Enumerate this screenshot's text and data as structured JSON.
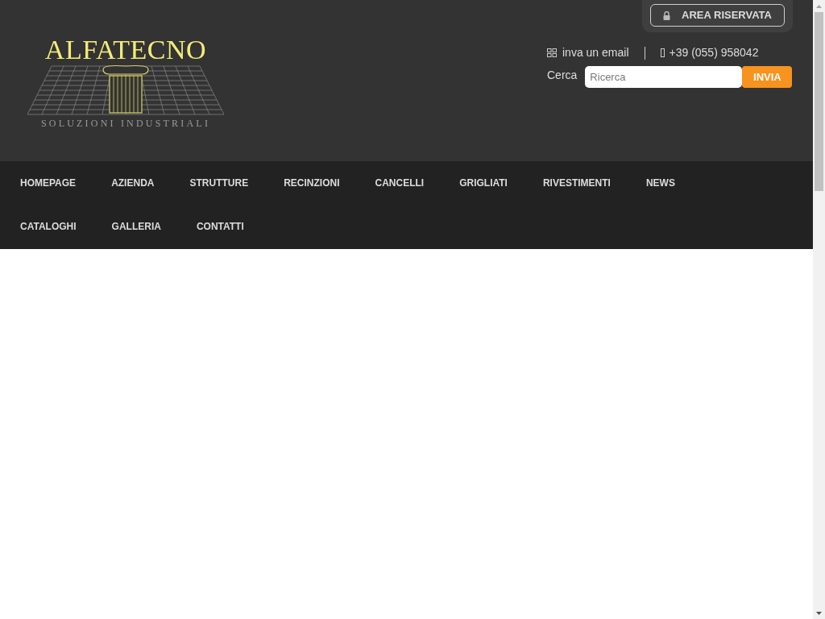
{
  "logo": {
    "title": "ALFATECNO",
    "subtitle": "SOLUZIONI INDUSTRIALI"
  },
  "reserved_button": {
    "label": "AREA RISERVATA"
  },
  "contacts": {
    "email": "inva un email",
    "phone": "+39 (055) 958042"
  },
  "search": {
    "label": "Cerca",
    "placeholder": "Ricerca",
    "button": "INVIA"
  },
  "menu": [
    "HOMEPAGE",
    "AZIENDA",
    "STRUTTURE",
    "RECINZIONI",
    "CANCELLI",
    "GRIGLIATI",
    "RIVESTIMENTI",
    "NEWS",
    "CATALOGHI",
    "GALLERIA",
    "CONTATTI"
  ]
}
